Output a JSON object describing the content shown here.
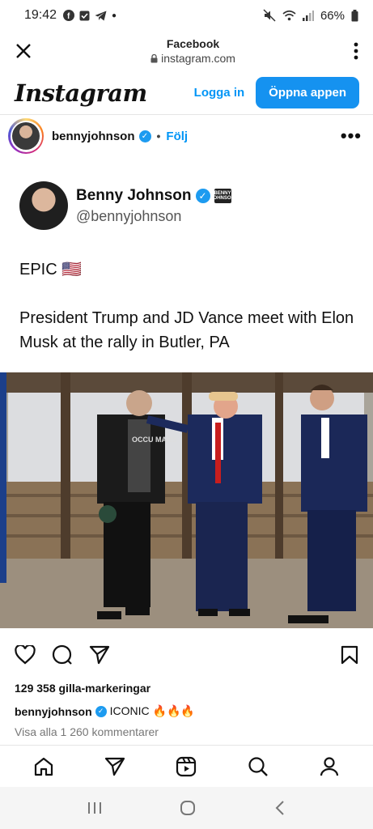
{
  "status_bar": {
    "time": "19:42",
    "battery": "66%",
    "left_icons": [
      "facebook-icon",
      "checkbox-icon",
      "telegram-icon",
      "dot-icon"
    ],
    "right_icons": [
      "mute-icon",
      "wifi-icon",
      "signal-icon",
      "battery-icon"
    ]
  },
  "browser": {
    "title": "Facebook",
    "url": "instagram.com"
  },
  "instagram_header": {
    "logo": "Instagram",
    "login_label": "Logga in",
    "open_app_label": "Öppna appen"
  },
  "post_header": {
    "username": "bennyjohnson",
    "separator": "•",
    "follow_label": "Följ",
    "more": "•••"
  },
  "tweet": {
    "name": "Benny Johnson",
    "handle": "@bennyjohnson",
    "badge_text": "BENNY JOHNSON",
    "text_line1": "EPIC 🇺🇸",
    "text_body": "President Trump and JD Vance meet with Elon Musk at the rally in Butler, PA"
  },
  "photo": {
    "shirt_text": "OCCU MARS"
  },
  "engagement": {
    "likes": "129 358 gilla-markeringar",
    "caption_user": "bennyjohnson",
    "caption_text": "ICONIC 🔥🔥🔥",
    "view_comments": "Visa alla 1 260 kommentarer"
  },
  "colors": {
    "accent": "#0095f6",
    "button": "#1592f0",
    "verified": "#1d9bf0"
  }
}
